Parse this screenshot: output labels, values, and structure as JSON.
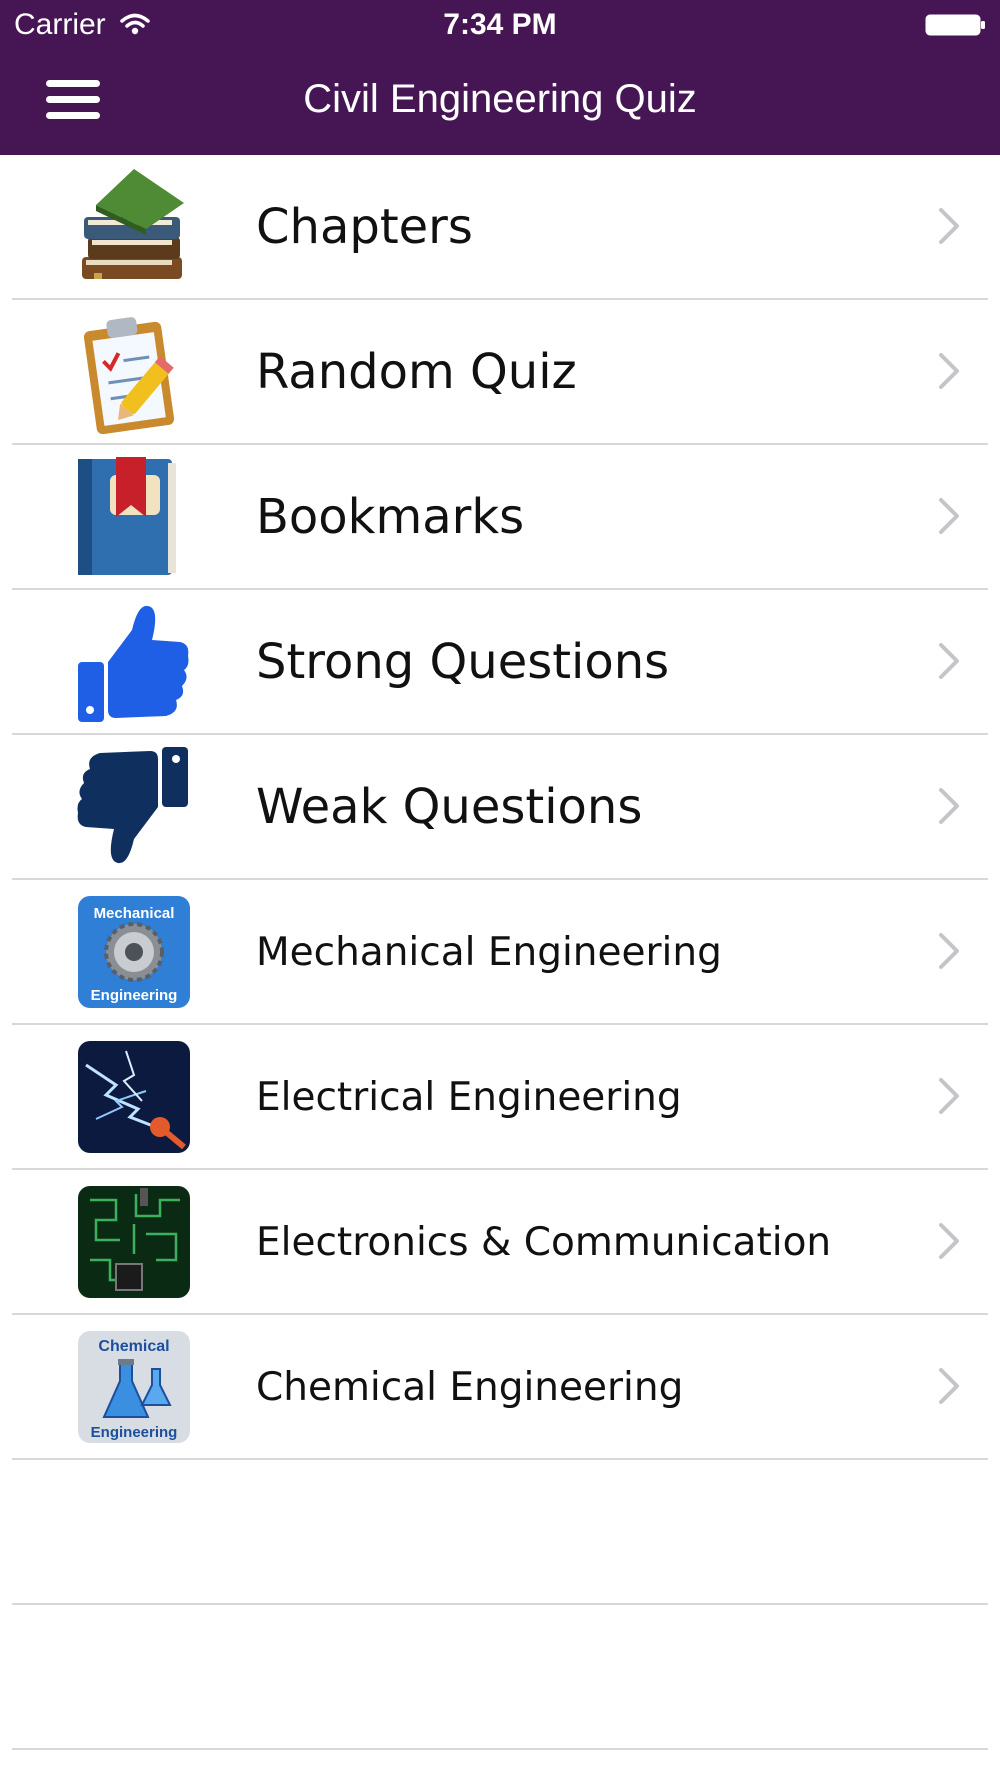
{
  "status_bar": {
    "carrier": "Carrier",
    "time": "7:34 PM",
    "wifi_icon": "wifi-icon",
    "battery_icon": "battery-icon"
  },
  "nav_bar": {
    "title": "Civil Engineering Quiz",
    "menu_icon": "hamburger-menu-icon",
    "background_color": "#461654"
  },
  "menu": [
    {
      "label": "Chapters",
      "icon": "books-icon"
    },
    {
      "label": "Random Quiz",
      "icon": "clipboard-pencil-icon"
    },
    {
      "label": "Bookmarks",
      "icon": "bookmark-book-icon"
    },
    {
      "label": "Strong Questions",
      "icon": "thumbs-up-icon"
    },
    {
      "label": "Weak Questions",
      "icon": "thumbs-down-icon"
    },
    {
      "label": "Mechanical Engineering",
      "icon": "mechanical-engineering-app-icon",
      "icon_text": [
        "Mechanical",
        "Engineering"
      ]
    },
    {
      "label": "Electrical Engineering",
      "icon": "electrical-lightning-app-icon"
    },
    {
      "label": "Electronics & Communication",
      "icon": "circuit-board-app-icon"
    },
    {
      "label": "Chemical Engineering",
      "icon": "chemical-engineering-app-icon",
      "icon_text": [
        "Chemical",
        "Engineering"
      ]
    }
  ]
}
